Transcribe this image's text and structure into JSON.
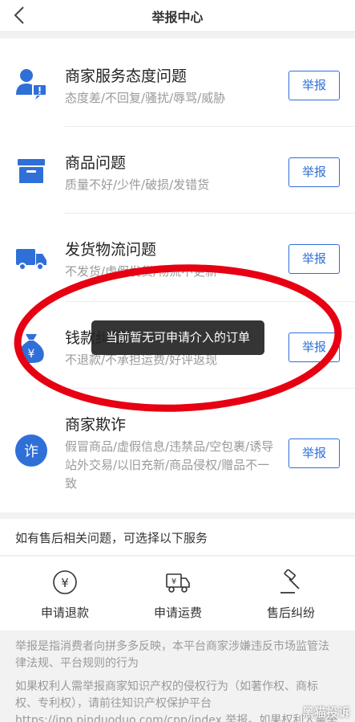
{
  "header": {
    "title": "举报中心",
    "back_icon": "chevron-left-icon"
  },
  "report_items": [
    {
      "title": "商家服务态度问题",
      "subtitle": "态度差/不回复/骚扰/辱骂/威胁",
      "button": "举报",
      "icon": "user-alert-icon"
    },
    {
      "title": "商品问题",
      "subtitle": "质量不好/少件/破损/发错货",
      "button": "举报",
      "icon": "box-icon"
    },
    {
      "title": "发货物流问题",
      "subtitle": "不发货/虚假发货/物流不更新",
      "button": "举报",
      "icon": "truck-icon"
    },
    {
      "title": "钱款纠纷",
      "subtitle": "不退款/不承担运费/好评返现",
      "button": "举报",
      "icon": "money-bag-icon"
    },
    {
      "title": "商家欺诈",
      "subtitle": "假冒商品/虚假信息/违禁品/空包裹/诱导站外交易/以旧充新/商品侵权/赠品不一致",
      "button": "举报",
      "icon": "fraud-icon"
    }
  ],
  "services": {
    "heading": "如有售后相关问题，可选择以下服务",
    "items": [
      {
        "label": "申请退款",
        "icon": "refund-icon"
      },
      {
        "label": "申请运费",
        "icon": "shipping-fee-icon"
      },
      {
        "label": "售后纠纷",
        "icon": "gavel-icon"
      }
    ]
  },
  "notes": {
    "line1": "举报是指消费者向拼多多反映，本平台商家涉嫌违反市场监管法律法规、平台规则的行为",
    "line2": "如果权利人需举报商家知识产权的侵权行为（如著作权、商标权、专利权），请前往知识产权保护平台 https://ipp.pinduoduo.com/cpp/index 举报。如果权利人需举报商家侵害"
  },
  "toast": {
    "text": "当前暂无可申请介入的订单"
  },
  "watermark": {
    "text": "黑猫投诉"
  },
  "colors": {
    "accent": "#2f6fd8",
    "annotation": "#e60012"
  }
}
